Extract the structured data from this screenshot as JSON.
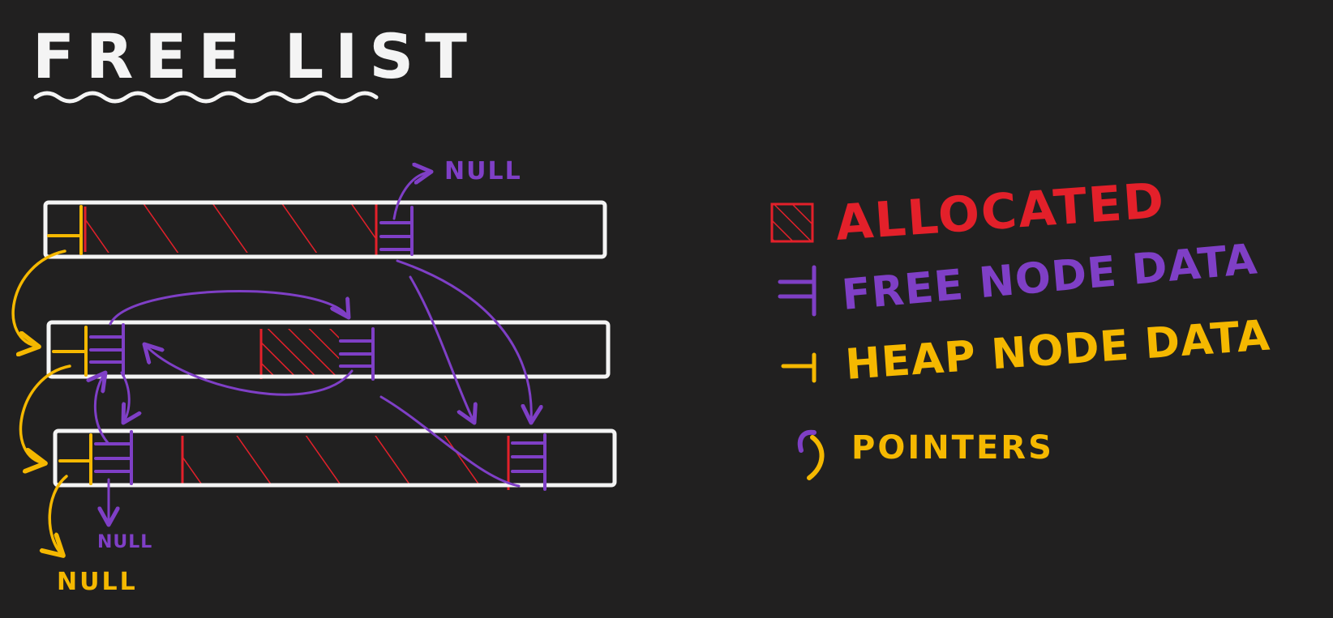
{
  "title": "FREE LIST",
  "colors": {
    "background": "#212020",
    "outline": "#f4f4f4",
    "allocated": "#e3202a",
    "free_node": "#7f3fc6",
    "heap_node": "#f5b800"
  },
  "labels": {
    "null_top": "NULL",
    "null_middle": "NULL",
    "null_bottom": "NULL"
  },
  "legend": [
    {
      "key": "allocated",
      "label": "ALLOCATED",
      "swatch": "hatched-square-icon"
    },
    {
      "key": "free_node",
      "label": "FREE NODE DATA",
      "swatch": "free-node-marker-icon"
    },
    {
      "key": "heap_node",
      "label": "HEAP NODE DATA",
      "swatch": "heap-node-marker-icon"
    },
    {
      "key": "pointer",
      "label": "POINTERS",
      "swatch": "curved-arrow-icon"
    }
  ],
  "heap_rows": [
    {
      "row": 1,
      "allocated_blocks": 1,
      "free_nodes": 1
    },
    {
      "row": 2,
      "allocated_blocks": 1,
      "free_nodes": 2
    },
    {
      "row": 3,
      "allocated_blocks": 1,
      "free_nodes": 2
    }
  ]
}
